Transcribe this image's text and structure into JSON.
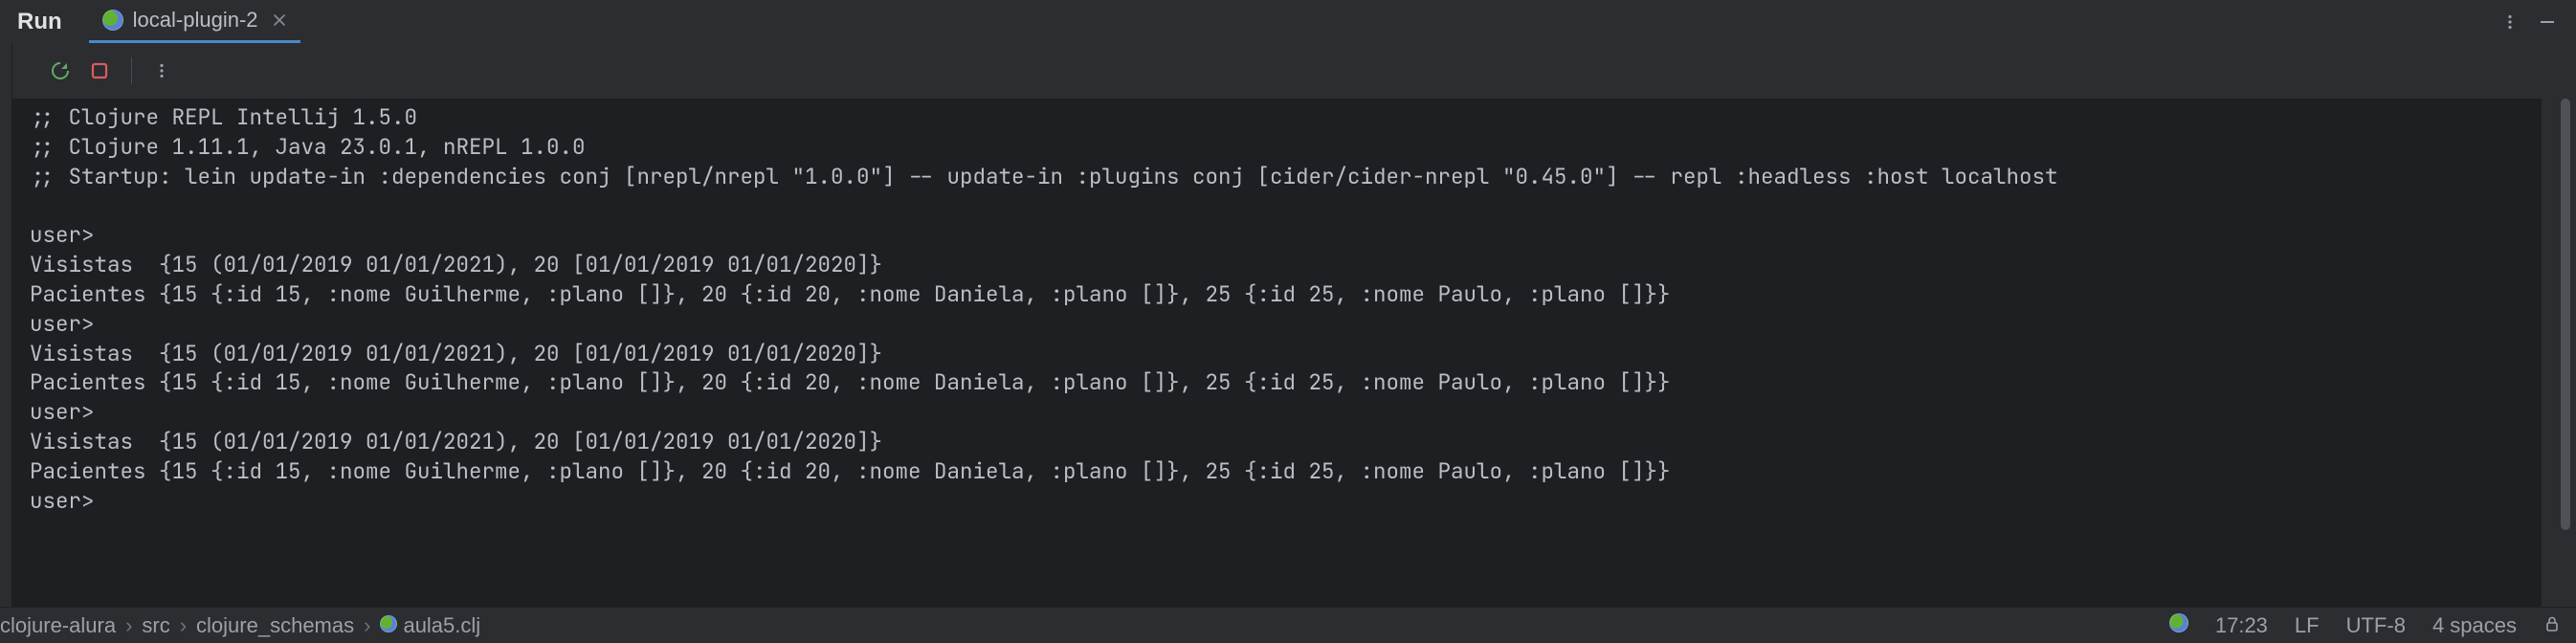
{
  "header": {
    "run_label": "Run",
    "tab_label": "local-plugin-2"
  },
  "console": {
    "lines": [
      ";; Clojure REPL Intellij 1.5.0",
      ";; Clojure 1.11.1, Java 23.0.1, nREPL 1.0.0",
      ";; Startup: lein update-in :dependencies conj [nrepl/nrepl \"1.0.0\"] -- update-in :plugins conj [cider/cider-nrepl \"0.45.0\"] -- repl :headless :host localhost",
      "",
      "user>",
      "Visistas  {15 (01/01/2019 01/01/2021), 20 [01/01/2019 01/01/2020]}",
      "Pacientes {15 {:id 15, :nome Guilherme, :plano []}, 20 {:id 20, :nome Daniela, :plano []}, 25 {:id 25, :nome Paulo, :plano []}}",
      "user>",
      "Visistas  {15 (01/01/2019 01/01/2021), 20 [01/01/2019 01/01/2020]}",
      "Pacientes {15 {:id 15, :nome Guilherme, :plano []}, 20 {:id 20, :nome Daniela, :plano []}, 25 {:id 25, :nome Paulo, :plano []}}",
      "user>",
      "Visistas  {15 (01/01/2019 01/01/2021), 20 [01/01/2019 01/01/2020]}",
      "Pacientes {15 {:id 15, :nome Guilherme, :plano []}, 20 {:id 20, :nome Daniela, :plano []}, 25 {:id 25, :nome Paulo, :plano []}}",
      "user>"
    ]
  },
  "breadcrumbs": {
    "seg0": "clojure-alura",
    "seg1": "src",
    "seg2": "clojure_schemas",
    "seg3": "aula5.clj"
  },
  "status": {
    "time": "17:23",
    "line_sep": "LF",
    "encoding": "UTF-8",
    "indent": "4 spaces"
  }
}
